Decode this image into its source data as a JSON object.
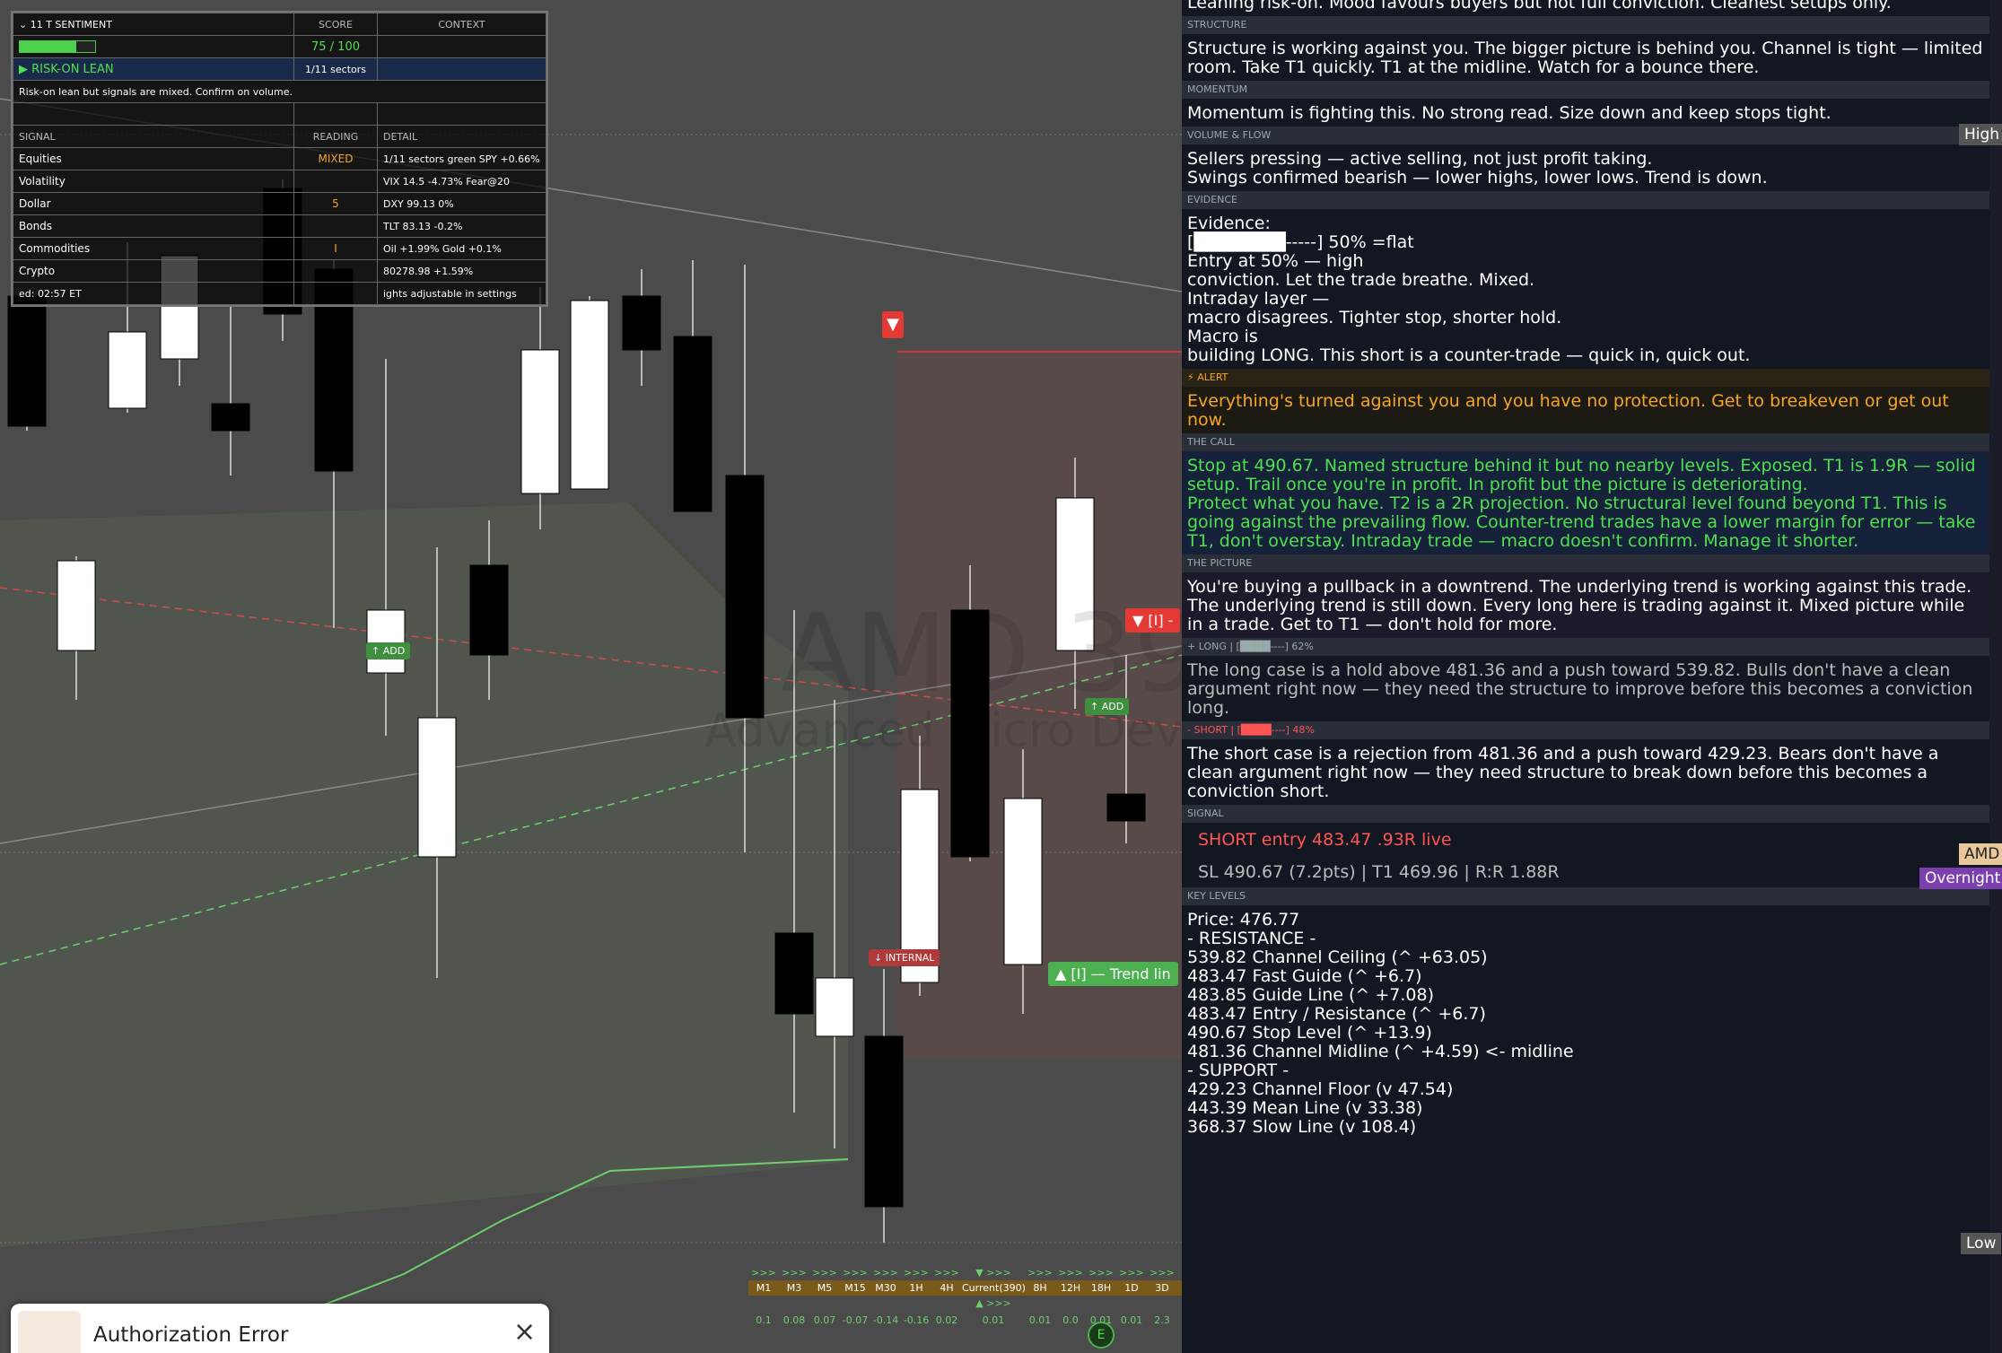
{
  "sentiment": {
    "menu_count": "11",
    "title": "T SENTIMENT",
    "col_score": "SCORE",
    "col_context": "CONTEXT",
    "score": "75 / 100",
    "score_fraction": 0.75,
    "lean": "▶ RISK-ON LEAN",
    "lean_sectors": "1/11 sectors",
    "note": "Risk-on lean but signals are mixed. Confirm on volume.",
    "col_signal": "SIGNAL",
    "col_reading": "READING",
    "col_detail": "DETAIL",
    "rows": [
      {
        "signal": "Equities",
        "reading": "MIXED",
        "detail": "1/11 sectors green  SPY +0.66%"
      },
      {
        "signal": "Volatility",
        "reading": "",
        "detail": "VIX 14.5  -4.73%  Fear@20"
      },
      {
        "signal": "Dollar",
        "reading": "5",
        "detail": "DXY 99.13  0%"
      },
      {
        "signal": "Bonds",
        "reading": "",
        "detail": "TLT 83.13  -0.2%"
      },
      {
        "signal": "Commodities",
        "reading": "I",
        "detail": "Oil +1.99%  Gold +0.1%"
      },
      {
        "signal": "Crypto",
        "reading": "",
        "detail": "80278.98  +1.59%"
      }
    ],
    "footer_left": "ed: 02:57 ET",
    "footer_right": "ights adjustable in settings"
  },
  "chart": {
    "watermark_symbol": "AMD",
    "watermark_num": "39",
    "watermark_name": "Advanced Micro Devic",
    "labels": {
      "add1": "↑ ADD",
      "add2": "↑ ADD",
      "internal": "↓ INTERNAL",
      "trend": "▲ [I] — Trend lin",
      "bracket": "▼ [I] -",
      "red_marker": "▼"
    }
  },
  "timeframes": {
    "arrows": [
      ">>>",
      ">>>",
      ">>>",
      ">>>",
      ">>>",
      ">>>",
      ">>>",
      "▼ >>>",
      ">>>",
      ">>>",
      ">>>",
      ">>>",
      ">>>"
    ],
    "labels": [
      "M1",
      "M3",
      "M5",
      "M15",
      "M30",
      "1H",
      "4H",
      "Current(390)",
      "8H",
      "12H",
      "18H",
      "1D",
      "3D"
    ],
    "arrows2": [
      "",
      "",
      "",
      "",
      "",
      "",
      "",
      "▲ >>>",
      "",
      "",
      "",
      "",
      ""
    ],
    "values": [
      "0.1",
      "0.08",
      "0.07",
      "-0.07",
      "-0.14",
      "-0.16",
      "0.02",
      "0.01",
      "0.01",
      "0.0",
      "0.01",
      "0.01",
      "2.3"
    ]
  },
  "toast": {
    "title": "Authorization Error",
    "close": "×"
  },
  "panel": {
    "intro": "Leaning risk-on. Mood favours buyers but not full conviction. Cleanest setups only.",
    "structure_h": "STRUCTURE",
    "structure": "Structure is working against you. The bigger picture is behind you. Channel is tight — limited room. Take T1 quickly. T1 at the midline. Watch for a bounce there.",
    "momentum_h": "MOMENTUM",
    "momentum": "Momentum is fighting this. No strong read. Size down and keep stops tight.",
    "volume_h": "VOLUME & FLOW",
    "volume": "Sellers pressing — active selling, not just profit taking.\nSwings confirmed bearish — lower highs, lower lows. Trend is down.",
    "evidence_h": "EVIDENCE",
    "evidence_title": "Evidence:",
    "evidence_bar": "[███████-----]  50% =flat",
    "evidence": "Entry at 50% — high\nconviction. Let the trade breathe.  Mixed.\nIntraday layer —\nmacro disagrees. Tighter stop, shorter hold.\nMacro is\nbuilding LONG. This short is a counter-trade — quick in, quick out.",
    "alert_h": "⚡ ALERT",
    "alert": "Everything's turned against you and you have no protection. Get to breakeven or get out now.",
    "call_h": "THE CALL",
    "call": "Stop at 490.67. Named structure behind it but no nearby levels. Exposed. T1 is 1.9R — solid setup. Trail once you're in profit. In profit but the picture is deteriorating.\nProtect what you have. T2 is a 2R projection. No structural level found beyond T1. This is going against the prevailing flow. Counter-trend trades have a lower margin for error — take T1, don't overstay. Intraday trade — macro doesn't confirm. Manage it shorter.",
    "picture_h": "THE PICTURE",
    "picture": "You're buying a pullback in a downtrend. The underlying trend is working against this trade. The underlying trend is still down. Every long here is trading against it. Mixed picture while in a trade. Get to T1 — don't hold for more.",
    "long_h": "+ LONG  |  [████----]  62%",
    "long_fraction": 0.62,
    "long": " The long case is a hold above 481.36 and a push toward 539.82. Bulls don't have a clean argument right now — they need the structure to improve before this becomes a conviction long.",
    "short_h": "- SHORT  |  [████----]  48%",
    "short_fraction": 0.48,
    "short": " The short case is a rejection from 481.36 and a push toward 429.23. Bears don't have a clean argument right now — they need structure to break down before this becomes a conviction short.",
    "signal_h": "SIGNAL",
    "signal_line1": "SHORT  entry 483.47  .93R live",
    "signal_line2": "SL 490.67  (7.2pts)  |  T1 469.96  |  R:R 1.88R",
    "levels_h": "KEY LEVELS",
    "levels": "Price: 476.77\n -  RESISTANCE  -\n539.82  Channel Ceiling  (^ +63.05)\n483.47  Fast Guide  (^ +6.7)\n483.85  Guide Line  (^ +7.08)\n483.47  Entry / Resistance  (^ +6.7)\n490.67  Stop Level  (^ +13.9)\n481.36  Channel Midline  (^ +4.59)  <- midline\n -  SUPPORT  -\n429.23  Channel Floor  (v 47.54)\n443.39  Mean Line  (v 33.38)\n368.37  Slow Line  (v 108.4)"
  },
  "scale": {
    "high": "High",
    "symbol": "AMD",
    "overnight": "Overnight",
    "low": "Low"
  },
  "colors": {
    "bg": "#4b4b4b",
    "panel": "#131722",
    "green": "#4ee04e",
    "orange": "#f5a623",
    "red": "#e53935",
    "purple": "#7b3fb0"
  }
}
